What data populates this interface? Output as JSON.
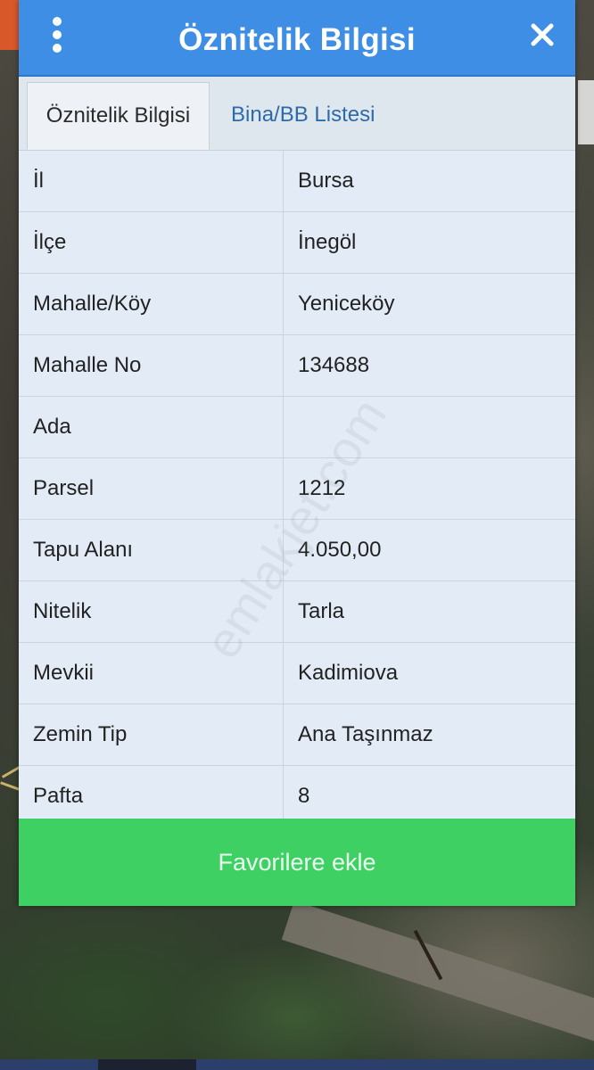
{
  "header": {
    "title": "Öznitelik Bilgisi",
    "menu_icon": "more-vertical-icon",
    "close_icon": "close-icon"
  },
  "tabs": [
    {
      "label": "Öznitelik Bilgisi",
      "active": true
    },
    {
      "label": "Bina/BB Listesi",
      "active": false
    }
  ],
  "attributes": [
    {
      "label": "İl",
      "value": "Bursa"
    },
    {
      "label": "İlçe",
      "value": "İnegöl"
    },
    {
      "label": "Mahalle/Köy",
      "value": "Yeniceköy"
    },
    {
      "label": "Mahalle No",
      "value": "134688"
    },
    {
      "label": "Ada",
      "value": ""
    },
    {
      "label": "Parsel",
      "value": "1212"
    },
    {
      "label": "Tapu Alanı",
      "value": "4.050,00"
    },
    {
      "label": "Nitelik",
      "value": "Tarla"
    },
    {
      "label": "Mevkii",
      "value": "Kadimiova"
    },
    {
      "label": "Zemin Tip",
      "value": "Ana Taşınmaz"
    },
    {
      "label": "Pafta",
      "value": "8"
    }
  ],
  "actions": {
    "favorite_label": "Favorilere ekle"
  },
  "watermark": "emlakjet.com",
  "colors": {
    "header": "#3d8ee4",
    "favorite_button": "#3ed062",
    "row_background": "#e3ecf6",
    "tab_inactive_text": "#2e6aa8"
  }
}
